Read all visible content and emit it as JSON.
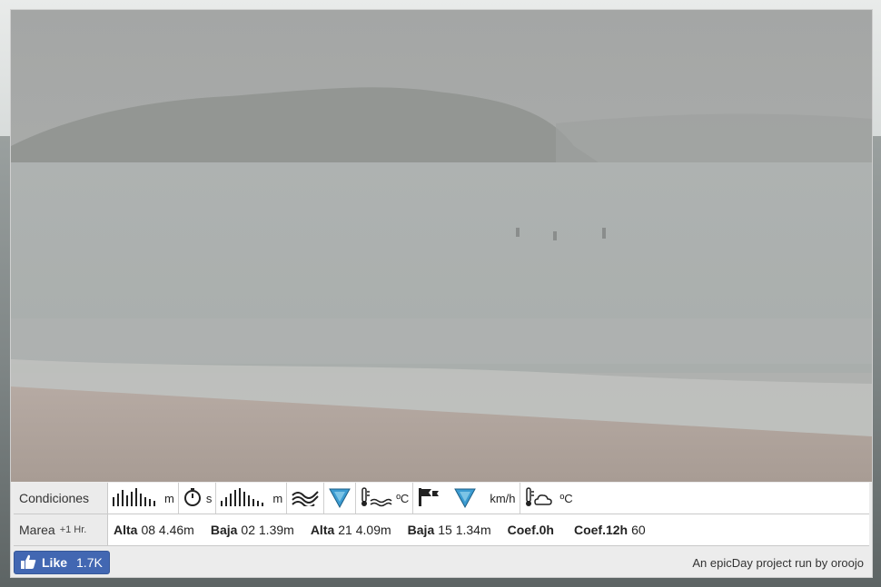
{
  "conditions": {
    "label": "Condiciones",
    "wave_height_unit": "m",
    "period_unit": "s",
    "swell_height_unit": "m",
    "water_temp_unit": "ºC",
    "wind_unit": "km/h",
    "air_temp_unit": "ºC",
    "icons": [
      "wave-bars-icon",
      "stopwatch-icon",
      "swell-bars-icon",
      "swell-waves-icon",
      "swell-direction-icon",
      "water-thermometer-icon",
      "wind-flag-icon",
      "wind-direction-icon",
      "weather-thermometer-icon"
    ]
  },
  "tides": {
    "label": "Marea",
    "label_sub": "+1 Hr.",
    "entries": [
      {
        "type": "Alta",
        "hour": "08",
        "height": "4.46m"
      },
      {
        "type": "Baja",
        "hour": "02",
        "height": "1.39m"
      },
      {
        "type": "Alta",
        "hour": "21",
        "height": "4.09m"
      },
      {
        "type": "Baja",
        "hour": "15",
        "height": "1.34m"
      }
    ],
    "coef0_label": "Coef.0h",
    "coef0_value": "",
    "coef12_label": "Coef.12h",
    "coef12_value": "60"
  },
  "footer": {
    "like_label": "Like",
    "like_count": "1.7K",
    "credit_text": "An epicDay project run by oroojo"
  },
  "colors": {
    "facebook_blue": "#4267b2",
    "direction_arrow": "#3b9bd1"
  }
}
